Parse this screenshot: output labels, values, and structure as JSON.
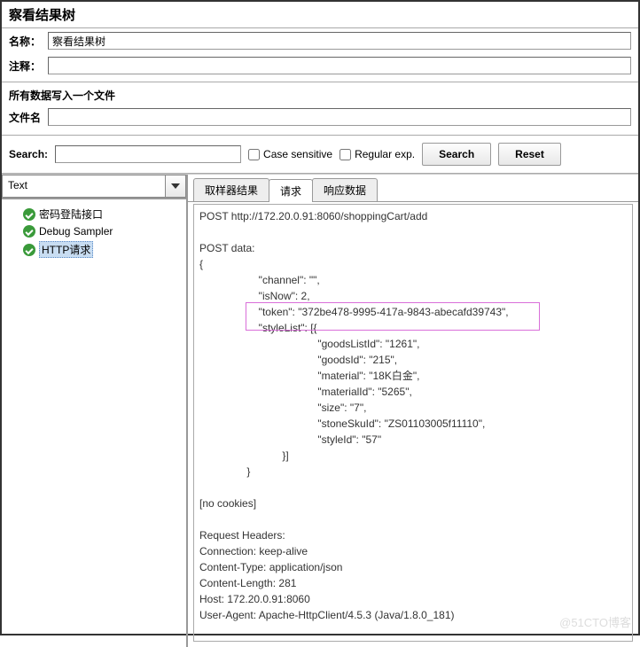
{
  "title": "察看结果树",
  "fields": {
    "name_label": "名称：",
    "name_value": "察看结果树",
    "comment_label": "注释：",
    "comment_value": ""
  },
  "file_section": {
    "header": "所有数据写入一个文件",
    "filename_label": "文件名",
    "filename_value": ""
  },
  "search": {
    "label": "Search:",
    "value": "",
    "case_label": "Case sensitive",
    "regex_label": "Regular exp.",
    "search_btn": "Search",
    "reset_btn": "Reset"
  },
  "view_selector": "Text",
  "tree": {
    "items": [
      {
        "label": "密码登陆接口",
        "selected": false
      },
      {
        "label": "Debug Sampler",
        "selected": false
      },
      {
        "label": "HTTP请求",
        "selected": true
      }
    ]
  },
  "tabs": {
    "items": [
      "取样器结果",
      "请求",
      "响应数据"
    ],
    "active": 1
  },
  "request_body": "POST http://172.20.0.91:8060/shoppingCart/add\n\nPOST data:\n{\n                    \"channel\": \"\",\n                    \"isNow\": 2,\n                    \"token\": \"372be478-9995-417a-9843-abecafd39743\",\n                    \"styleList\": [{\n                                        \"goodsListId\": \"1261\",\n                                        \"goodsId\": \"215\",\n                                        \"material\": \"18K白金\",\n                                        \"materialId\": \"5265\",\n                                        \"size\": \"7\",\n                                        \"stoneSkuId\": \"ZS01103005f11110\",\n                                        \"styleId\": \"57\"\n                            }]\n                }\n\n[no cookies]\n\nRequest Headers:\nConnection: keep-alive\nContent-Type: application/json\nContent-Length: 281\nHost: 172.20.0.91:8060\nUser-Agent: Apache-HttpClient/4.5.3 (Java/1.8.0_181)",
  "watermark": "@51CTO博客"
}
